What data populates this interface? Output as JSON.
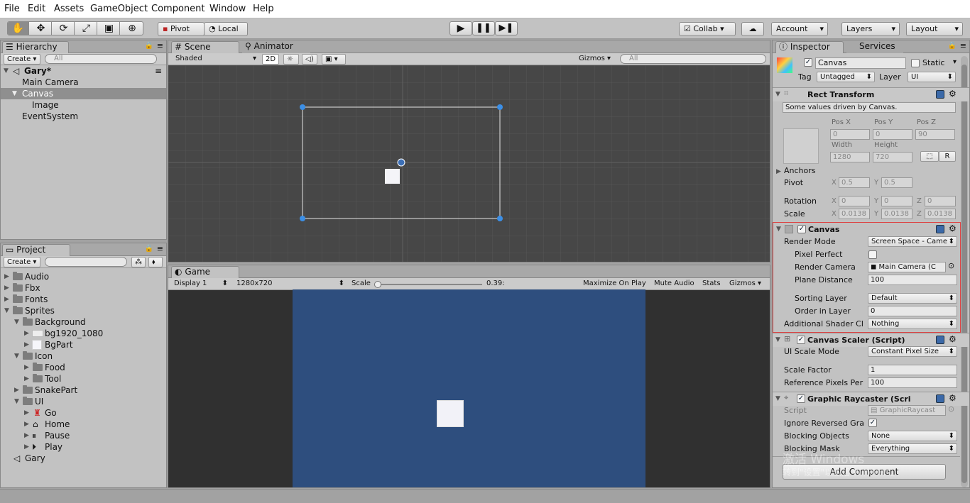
{
  "menu": [
    "File",
    "Edit",
    "Assets",
    "GameObject",
    "Component",
    "Window",
    "Help"
  ],
  "toolbar": {
    "pivot": "Pivot",
    "local": "Local",
    "collab": "Collab ▾",
    "account": "Account",
    "layers": "Layers",
    "layout": "Layout"
  },
  "hierarchy": {
    "tab": "Hierarchy",
    "create": "Create ▾",
    "search": "All",
    "scene": "Gary*",
    "items": [
      "Main Camera",
      "Canvas",
      "Image",
      "EventSystem"
    ]
  },
  "scene": {
    "tab": "Scene",
    "tab2": "Animator",
    "shading": "Shaded",
    "mode2d": "2D",
    "gizmos": "Gizmos ▾",
    "search": "All"
  },
  "game": {
    "tab": "Game",
    "display": "Display 1",
    "resolution": "1280x720",
    "scale_label": "Scale",
    "scale_value": "0.39:",
    "maximize": "Maximize On Play",
    "mute": "Mute Audio",
    "stats": "Stats",
    "gizmos": "Gizmos"
  },
  "project": {
    "tab": "Project",
    "create": "Create ▾",
    "items": [
      "Audio",
      "Fbx",
      "Fonts",
      "Sprites",
      "Background",
      "bg1920_1080",
      "BgPart",
      "Icon",
      "Food",
      "Tool",
      "SnakePart",
      "UI",
      "Go",
      "Home",
      "Pause",
      "Play",
      "Gary"
    ]
  },
  "inspector": {
    "tab": "Inspector",
    "tab2": "Services",
    "name": "Canvas",
    "static": "Static",
    "tag_label": "Tag",
    "tag": "Untagged",
    "layer_label": "Layer",
    "layer": "UI",
    "rect": {
      "title": "Rect Transform",
      "note": "Some values driven by Canvas.",
      "posx": "Pos X",
      "posy": "Pos Y",
      "posz": "Pos Z",
      "vx": "0",
      "vy": "0",
      "vz": "90",
      "width_label": "Width",
      "height_label": "Height",
      "width": "1280",
      "height": "720",
      "r": "R",
      "anchors": "Anchors",
      "pivot": "Pivot",
      "px": "0.5",
      "py": "0.5",
      "rotation": "Rotation",
      "rx": "0",
      "ry": "0",
      "rz": "0",
      "scale": "Scale",
      "sx": "0.0138",
      "sy": "0.0138",
      "sz": "0.0138",
      "X": "X",
      "Y": "Y",
      "Z": "Z"
    },
    "canvas": {
      "title": "Canvas",
      "render_mode_label": "Render Mode",
      "render_mode": "Screen Space - Came",
      "pixel_perfect": "Pixel Perfect",
      "render_camera_label": "Render Camera",
      "render_camera": "Main Camera (C",
      "plane_distance_label": "Plane Distance",
      "plane_distance": "100",
      "sorting_layer_label": "Sorting Layer",
      "sorting_layer": "Default",
      "order_label": "Order in Layer",
      "order": "0",
      "shader_label": "Additional Shader Cl",
      "shader": "Nothing"
    },
    "scaler": {
      "title": "Canvas Scaler (Script)",
      "mode_label": "UI Scale Mode",
      "mode": "Constant Pixel Size",
      "factor_label": "Scale Factor",
      "factor": "1",
      "ref_label": "Reference Pixels Per",
      "ref": "100"
    },
    "raycaster": {
      "title": "Graphic Raycaster (Scri",
      "script_label": "Script",
      "script": "GraphicRaycast",
      "ignore_label": "Ignore Reversed Gra",
      "blocking_label": "Blocking Objects",
      "blocking": "None",
      "mask_label": "Blocking Mask",
      "mask": "Everything"
    },
    "add_component": "Add Component",
    "watermark": "激活 Windows",
    "watermark2": "转到\"设置\"以激活 Windows。"
  }
}
